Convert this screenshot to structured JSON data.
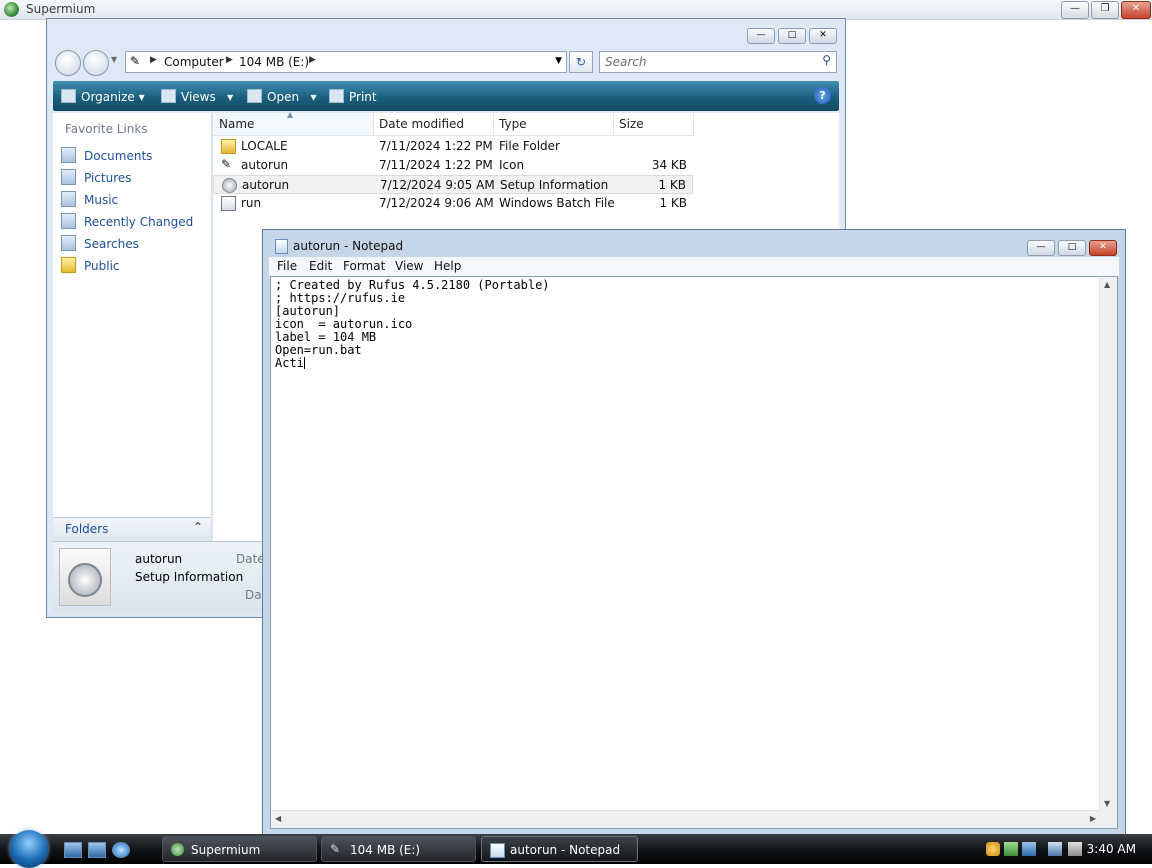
{
  "browser": {
    "title": "Supermium"
  },
  "explorer": {
    "breadcrumbs": [
      "Computer",
      "104 MB (E:)"
    ],
    "search_placeholder": "Search",
    "toolbar": {
      "organize": "Organize",
      "views": "Views",
      "open": "Open",
      "print": "Print"
    },
    "favorites_title": "Favorite Links",
    "favorites": [
      "Documents",
      "Pictures",
      "Music",
      "Recently Changed",
      "Searches",
      "Public"
    ],
    "folders_label": "Folders",
    "columns": [
      "Name",
      "Date modified",
      "Type",
      "Size"
    ],
    "files": [
      {
        "name": "LOCALE",
        "date": "7/11/2024 1:22 PM",
        "type": "File Folder",
        "size": "",
        "icon": "folder-icon"
      },
      {
        "name": "autorun",
        "date": "7/11/2024 1:22 PM",
        "type": "Icon",
        "size": "34 KB",
        "icon": "usb-drive-icon"
      },
      {
        "name": "autorun",
        "date": "7/12/2024 9:05 AM",
        "type": "Setup Information",
        "size": "1 KB",
        "icon": "setup-gear-icon",
        "selected": true
      },
      {
        "name": "run",
        "date": "7/12/2024 9:06 AM",
        "type": "Windows Batch File",
        "size": "1 KB",
        "icon": "batch-file-icon"
      }
    ],
    "details": {
      "name": "autorun",
      "type": "Setup Information",
      "date_label_1": "Date",
      "date_label_2": "Dat"
    }
  },
  "notepad": {
    "title": "autorun - Notepad",
    "menu": [
      "File",
      "Edit",
      "Format",
      "View",
      "Help"
    ],
    "lines": [
      "; Created by Rufus 4.5.2180 (Portable)",
      "; https://rufus.ie",
      "[autorun]",
      "icon  = autorun.ico",
      "label = 104 MB",
      "Open=run.bat",
      "Acti"
    ]
  },
  "taskbar": {
    "buttons": [
      {
        "label": "Supermium",
        "icon": "supermium-icon"
      },
      {
        "label": "104 MB (E:)",
        "icon": "usb-drive-icon"
      },
      {
        "label": "autorun - Notepad",
        "icon": "notepad-icon",
        "active": true
      }
    ],
    "clock": "3:40 AM"
  },
  "colors": {
    "accent": "#1e4f9c",
    "toolbar": "#1b5f7e",
    "close": "#c5432a"
  }
}
